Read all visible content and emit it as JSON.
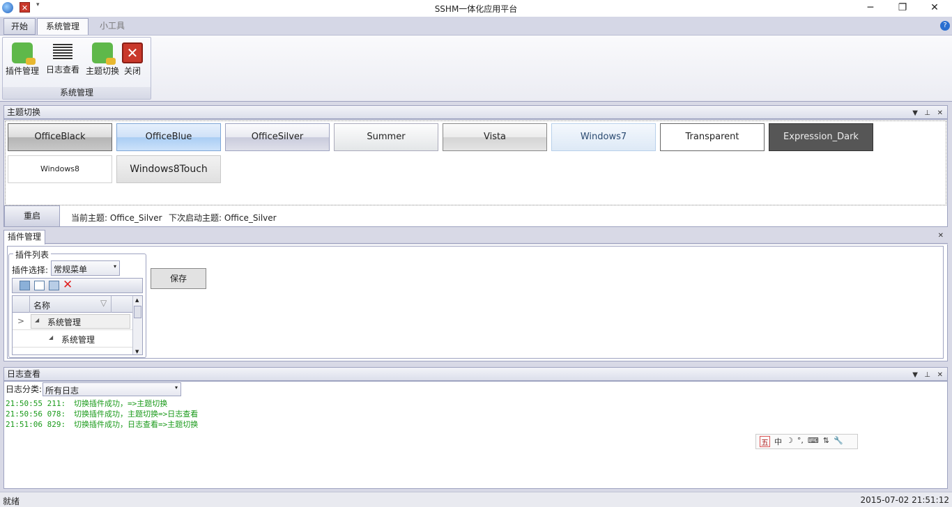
{
  "window": {
    "title": "SSHM一体化应用平台",
    "minimize": "─",
    "restore": "❐",
    "close": "✕"
  },
  "ribbon": {
    "tabs": [
      "开始",
      "系统管理",
      "小工具"
    ],
    "group_label": "系统管理",
    "buttons": [
      "插件管理",
      "日志查看",
      "主题切换",
      "关闭"
    ]
  },
  "theme_panel": {
    "title": "主题切换",
    "themes": [
      "OfficeBlack",
      "OfficeBlue",
      "OfficeSilver",
      "Summer",
      "Vista",
      "Windows7",
      "Transparent",
      "Expression_Dark",
      "Windows8",
      "Windows8Touch"
    ],
    "restart": "重启",
    "current": "当前主题: Office_Silver",
    "next": "下次启动主题: Office_Silver"
  },
  "plugin_panel": {
    "tab": "插件管理",
    "group": "插件列表",
    "select_label": "插件选择:",
    "select_value": "常规菜单",
    "save": "保存",
    "column": "名称",
    "rows": [
      "系统管理",
      "系统管理"
    ]
  },
  "log_panel": {
    "title": "日志查看",
    "filter_label": "日志分类:",
    "filter_value": "所有日志",
    "entries": [
      {
        "time": "21:50:55 211:",
        "msg": "切换插件成功，=>主题切换"
      },
      {
        "time": "21:50:56 078:",
        "msg": "切换插件成功，主题切换=>日志查看"
      },
      {
        "time": "21:51:06 829:",
        "msg": "切换插件成功，日志查看=>主题切换"
      }
    ]
  },
  "ime": [
    "五",
    "中",
    "☽",
    "°,",
    "⌨",
    "⇅",
    "🔧"
  ],
  "status": {
    "left": "就绪",
    "right": "2015-07-02 21:51:12"
  }
}
